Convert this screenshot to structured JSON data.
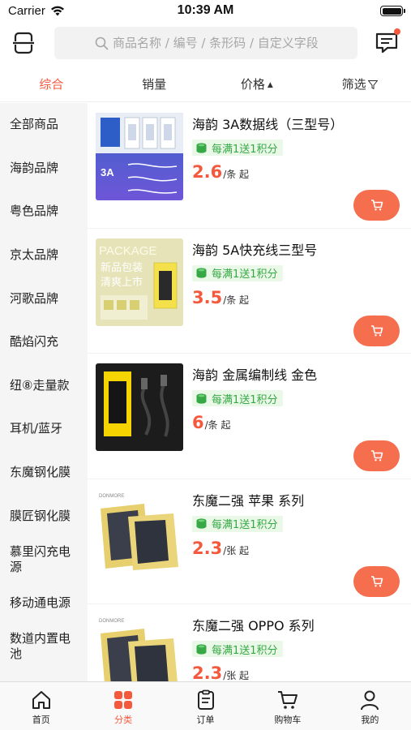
{
  "status_bar": {
    "carrier": "Carrier",
    "time": "10:39 AM"
  },
  "search": {
    "placeholder": "商品名称 / 编号 / 条形码 / 自定义字段"
  },
  "sort_tabs": [
    {
      "label": "综合",
      "active": true
    },
    {
      "label": "销量",
      "active": false
    },
    {
      "label": "价格",
      "icon": "sort-arrows-icon"
    },
    {
      "label": "筛选",
      "icon": "filter-icon"
    }
  ],
  "sidebar": {
    "items": [
      {
        "label": "全部商品"
      },
      {
        "label": "海韵品牌"
      },
      {
        "label": "粤色品牌"
      },
      {
        "label": "京太品牌"
      },
      {
        "label": "河歌品牌"
      },
      {
        "label": "酷焰闪充"
      },
      {
        "label": "纽⑧走量款"
      },
      {
        "label": "耳机/蓝牙"
      },
      {
        "label": "东魔钢化膜"
      },
      {
        "label": "膜匠钢化膜"
      },
      {
        "label": "慕里闪充电源"
      },
      {
        "label": "移动通电源"
      },
      {
        "label": "数道内置电池"
      }
    ]
  },
  "products": [
    {
      "name": "海韵 3A数据线（三型号）",
      "badge": "每满1送1积分",
      "price": "2.6",
      "unit": "/条 起",
      "thumb_icon": "usb-cable-package-blue-image"
    },
    {
      "name": "海韵 5A快充线三型号",
      "badge": "每满1送1积分",
      "price": "3.5",
      "unit": "/条 起",
      "thumb_icon": "usb-cable-package-yellow-image",
      "thumb_text": {
        "line1": "PACKAGE",
        "line2": "新品包装",
        "line3": "清爽上市"
      }
    },
    {
      "name": "海韵 金属编制线 金色",
      "badge": "每满1送1积分",
      "price": "6",
      "unit": "/条 起",
      "thumb_icon": "braided-cable-black-box-image"
    },
    {
      "name": "东魔二强 苹果 系列",
      "badge": "每满1送1积分",
      "price": "2.3",
      "unit": "/张 起",
      "thumb_icon": "screen-protector-package-image",
      "thumb_brand": "DONMORE"
    },
    {
      "name": "东魔二强 OPPO 系列",
      "badge": "每满1送1积分",
      "price": "2.3",
      "unit": "/张 起",
      "thumb_icon": "screen-protector-package-image",
      "thumb_brand": "DONMORE"
    }
  ],
  "bottom_nav": [
    {
      "label": "首页",
      "icon": "home-icon",
      "active": false
    },
    {
      "label": "分类",
      "icon": "category-grid-icon",
      "active": true
    },
    {
      "label": "订单",
      "icon": "order-clipboard-icon",
      "active": false
    },
    {
      "label": "购物车",
      "icon": "shopping-cart-icon",
      "active": false
    },
    {
      "label": "我的",
      "icon": "profile-icon",
      "active": false
    }
  ],
  "colors": {
    "accent": "#f4593d",
    "cart_button": "#f56e4e",
    "badge_bg": "#eaf8e8",
    "badge_text": "#36a845",
    "sidebar_bg": "#f5f5f5"
  }
}
